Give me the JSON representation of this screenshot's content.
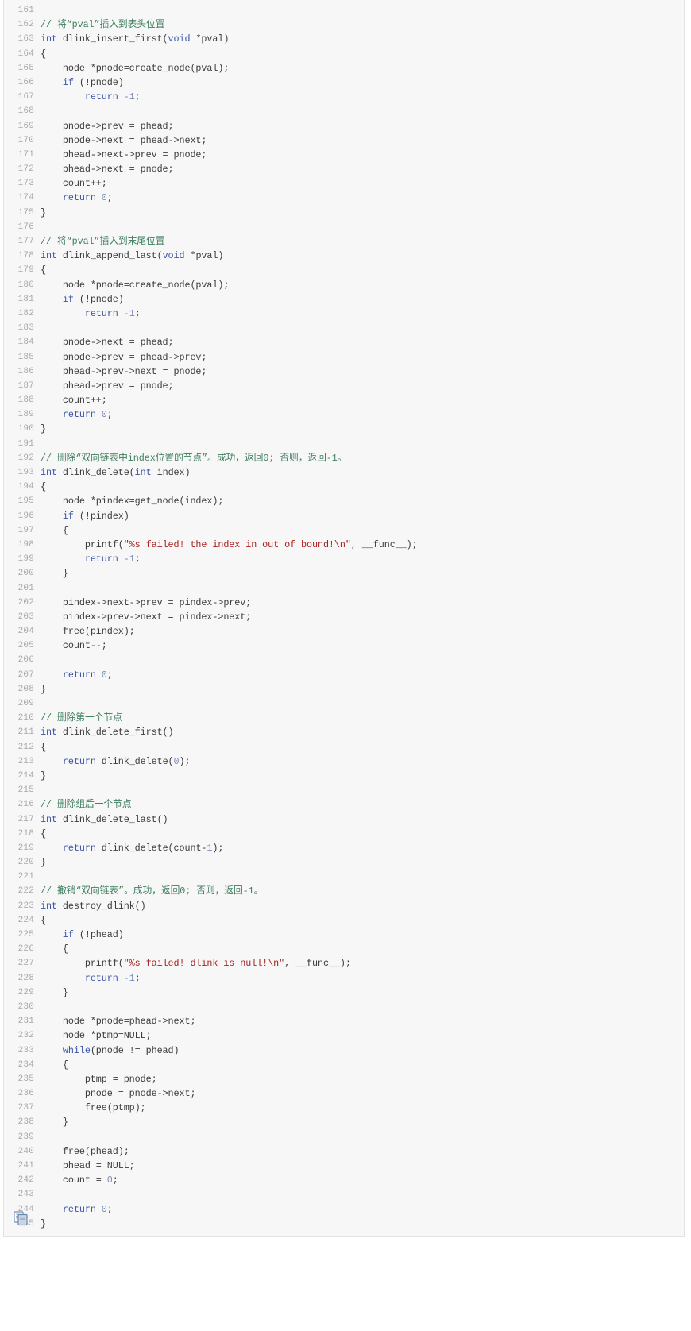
{
  "viewer": {
    "language": "C",
    "first_line_number": 161,
    "last_line_number": 245,
    "copy_icon": "copy-pages-icon",
    "colors": {
      "background": "#f7f7f7",
      "border": "#e3e3e3",
      "line_number": "#a8a8a8",
      "text": "#3b3b3b",
      "comment": "#3f7f5f",
      "keyword": "#3c55a8",
      "string": "#aa2222",
      "number": "#7a8ab8"
    }
  },
  "code": [
    {
      "n": "161",
      "tokens": []
    },
    {
      "n": "162",
      "tokens": [
        {
          "t": "com",
          "v": "// 将“pval”插入到表头位置"
        }
      ]
    },
    {
      "n": "163",
      "tokens": [
        {
          "t": "kw",
          "v": "int"
        },
        {
          "t": "pln",
          "v": " dlink_insert_first("
        },
        {
          "t": "kw",
          "v": "void"
        },
        {
          "t": "pln",
          "v": " *pval)"
        }
      ]
    },
    {
      "n": "164",
      "tokens": [
        {
          "t": "pln",
          "v": "{"
        }
      ]
    },
    {
      "n": "165",
      "tokens": [
        {
          "t": "pln",
          "v": "    node *pnode=create_node(pval);"
        }
      ]
    },
    {
      "n": "166",
      "tokens": [
        {
          "t": "pln",
          "v": "    "
        },
        {
          "t": "kw",
          "v": "if"
        },
        {
          "t": "pln",
          "v": " (!pnode)"
        }
      ]
    },
    {
      "n": "167",
      "tokens": [
        {
          "t": "pln",
          "v": "        "
        },
        {
          "t": "kw",
          "v": "return"
        },
        {
          "t": "pln",
          "v": " "
        },
        {
          "t": "num",
          "v": "-1"
        },
        {
          "t": "pln",
          "v": ";"
        }
      ]
    },
    {
      "n": "168",
      "tokens": []
    },
    {
      "n": "169",
      "tokens": [
        {
          "t": "pln",
          "v": "    pnode->prev = phead;"
        }
      ]
    },
    {
      "n": "170",
      "tokens": [
        {
          "t": "pln",
          "v": "    pnode->next = phead->next;"
        }
      ]
    },
    {
      "n": "171",
      "tokens": [
        {
          "t": "pln",
          "v": "    phead->next->prev = pnode;"
        }
      ]
    },
    {
      "n": "172",
      "tokens": [
        {
          "t": "pln",
          "v": "    phead->next = pnode;"
        }
      ]
    },
    {
      "n": "173",
      "tokens": [
        {
          "t": "pln",
          "v": "    count++;"
        }
      ]
    },
    {
      "n": "174",
      "tokens": [
        {
          "t": "pln",
          "v": "    "
        },
        {
          "t": "kw",
          "v": "return"
        },
        {
          "t": "pln",
          "v": " "
        },
        {
          "t": "num",
          "v": "0"
        },
        {
          "t": "pln",
          "v": ";"
        }
      ]
    },
    {
      "n": "175",
      "tokens": [
        {
          "t": "pln",
          "v": "}"
        }
      ]
    },
    {
      "n": "176",
      "tokens": []
    },
    {
      "n": "177",
      "tokens": [
        {
          "t": "com",
          "v": "// 将“pval”插入到末尾位置"
        }
      ]
    },
    {
      "n": "178",
      "tokens": [
        {
          "t": "kw",
          "v": "int"
        },
        {
          "t": "pln",
          "v": " dlink_append_last("
        },
        {
          "t": "kw",
          "v": "void"
        },
        {
          "t": "pln",
          "v": " *pval)"
        }
      ]
    },
    {
      "n": "179",
      "tokens": [
        {
          "t": "pln",
          "v": "{"
        }
      ]
    },
    {
      "n": "180",
      "tokens": [
        {
          "t": "pln",
          "v": "    node *pnode=create_node(pval);"
        }
      ]
    },
    {
      "n": "181",
      "tokens": [
        {
          "t": "pln",
          "v": "    "
        },
        {
          "t": "kw",
          "v": "if"
        },
        {
          "t": "pln",
          "v": " (!pnode)"
        }
      ]
    },
    {
      "n": "182",
      "tokens": [
        {
          "t": "pln",
          "v": "        "
        },
        {
          "t": "kw",
          "v": "return"
        },
        {
          "t": "pln",
          "v": " "
        },
        {
          "t": "num",
          "v": "-1"
        },
        {
          "t": "pln",
          "v": ";"
        }
      ]
    },
    {
      "n": "183",
      "tokens": []
    },
    {
      "n": "184",
      "tokens": [
        {
          "t": "pln",
          "v": "    pnode->next = phead;"
        }
      ]
    },
    {
      "n": "185",
      "tokens": [
        {
          "t": "pln",
          "v": "    pnode->prev = phead->prev;"
        }
      ]
    },
    {
      "n": "186",
      "tokens": [
        {
          "t": "pln",
          "v": "    phead->prev->next = pnode;"
        }
      ]
    },
    {
      "n": "187",
      "tokens": [
        {
          "t": "pln",
          "v": "    phead->prev = pnode;"
        }
      ]
    },
    {
      "n": "188",
      "tokens": [
        {
          "t": "pln",
          "v": "    count++;"
        }
      ]
    },
    {
      "n": "189",
      "tokens": [
        {
          "t": "pln",
          "v": "    "
        },
        {
          "t": "kw",
          "v": "return"
        },
        {
          "t": "pln",
          "v": " "
        },
        {
          "t": "num",
          "v": "0"
        },
        {
          "t": "pln",
          "v": ";"
        }
      ]
    },
    {
      "n": "190",
      "tokens": [
        {
          "t": "pln",
          "v": "}"
        }
      ]
    },
    {
      "n": "191",
      "tokens": []
    },
    {
      "n": "192",
      "tokens": [
        {
          "t": "com",
          "v": "// 删除“双向链表中index位置的节点”。成功，返回0; 否则，返回-1。"
        }
      ]
    },
    {
      "n": "193",
      "tokens": [
        {
          "t": "kw",
          "v": "int"
        },
        {
          "t": "pln",
          "v": " dlink_delete("
        },
        {
          "t": "kw",
          "v": "int"
        },
        {
          "t": "pln",
          "v": " index)"
        }
      ]
    },
    {
      "n": "194",
      "tokens": [
        {
          "t": "pln",
          "v": "{"
        }
      ]
    },
    {
      "n": "195",
      "tokens": [
        {
          "t": "pln",
          "v": "    node *pindex=get_node(index);"
        }
      ]
    },
    {
      "n": "196",
      "tokens": [
        {
          "t": "pln",
          "v": "    "
        },
        {
          "t": "kw",
          "v": "if"
        },
        {
          "t": "pln",
          "v": " (!pindex)"
        }
      ]
    },
    {
      "n": "197",
      "tokens": [
        {
          "t": "pln",
          "v": "    {"
        }
      ]
    },
    {
      "n": "198",
      "tokens": [
        {
          "t": "pln",
          "v": "        printf("
        },
        {
          "t": "str",
          "v": "\"%s failed! the index in out of bound!\\n\""
        },
        {
          "t": "pln",
          "v": ", __func__);"
        }
      ]
    },
    {
      "n": "199",
      "tokens": [
        {
          "t": "pln",
          "v": "        "
        },
        {
          "t": "kw",
          "v": "return"
        },
        {
          "t": "pln",
          "v": " "
        },
        {
          "t": "num",
          "v": "-1"
        },
        {
          "t": "pln",
          "v": ";"
        }
      ]
    },
    {
      "n": "200",
      "tokens": [
        {
          "t": "pln",
          "v": "    }"
        }
      ]
    },
    {
      "n": "201",
      "tokens": []
    },
    {
      "n": "202",
      "tokens": [
        {
          "t": "pln",
          "v": "    pindex->next->prev = pindex->prev;"
        }
      ]
    },
    {
      "n": "203",
      "tokens": [
        {
          "t": "pln",
          "v": "    pindex->prev->next = pindex->next;"
        }
      ]
    },
    {
      "n": "204",
      "tokens": [
        {
          "t": "pln",
          "v": "    free(pindex);"
        }
      ]
    },
    {
      "n": "205",
      "tokens": [
        {
          "t": "pln",
          "v": "    count--;"
        }
      ]
    },
    {
      "n": "206",
      "tokens": []
    },
    {
      "n": "207",
      "tokens": [
        {
          "t": "pln",
          "v": "    "
        },
        {
          "t": "kw",
          "v": "return"
        },
        {
          "t": "pln",
          "v": " "
        },
        {
          "t": "num",
          "v": "0"
        },
        {
          "t": "pln",
          "v": ";"
        }
      ]
    },
    {
      "n": "208",
      "tokens": [
        {
          "t": "pln",
          "v": "}"
        }
      ]
    },
    {
      "n": "209",
      "tokens": []
    },
    {
      "n": "210",
      "tokens": [
        {
          "t": "com",
          "v": "// 删除第一个节点"
        }
      ]
    },
    {
      "n": "211",
      "tokens": [
        {
          "t": "kw",
          "v": "int"
        },
        {
          "t": "pln",
          "v": " dlink_delete_first()"
        }
      ]
    },
    {
      "n": "212",
      "tokens": [
        {
          "t": "pln",
          "v": "{"
        }
      ]
    },
    {
      "n": "213",
      "tokens": [
        {
          "t": "pln",
          "v": "    "
        },
        {
          "t": "kw",
          "v": "return"
        },
        {
          "t": "pln",
          "v": " dlink_delete("
        },
        {
          "t": "num",
          "v": "0"
        },
        {
          "t": "pln",
          "v": ");"
        }
      ]
    },
    {
      "n": "214",
      "tokens": [
        {
          "t": "pln",
          "v": "}"
        }
      ]
    },
    {
      "n": "215",
      "tokens": []
    },
    {
      "n": "216",
      "tokens": [
        {
          "t": "com",
          "v": "// 删除组后一个节点"
        }
      ]
    },
    {
      "n": "217",
      "tokens": [
        {
          "t": "kw",
          "v": "int"
        },
        {
          "t": "pln",
          "v": " dlink_delete_last()"
        }
      ]
    },
    {
      "n": "218",
      "tokens": [
        {
          "t": "pln",
          "v": "{"
        }
      ]
    },
    {
      "n": "219",
      "tokens": [
        {
          "t": "pln",
          "v": "    "
        },
        {
          "t": "kw",
          "v": "return"
        },
        {
          "t": "pln",
          "v": " dlink_delete(count-"
        },
        {
          "t": "num",
          "v": "1"
        },
        {
          "t": "pln",
          "v": ");"
        }
      ]
    },
    {
      "n": "220",
      "tokens": [
        {
          "t": "pln",
          "v": "}"
        }
      ]
    },
    {
      "n": "221",
      "tokens": []
    },
    {
      "n": "222",
      "tokens": [
        {
          "t": "com",
          "v": "// 撤销“双向链表”。成功，返回0; 否则，返回-1。"
        }
      ]
    },
    {
      "n": "223",
      "tokens": [
        {
          "t": "kw",
          "v": "int"
        },
        {
          "t": "pln",
          "v": " destroy_dlink()"
        }
      ]
    },
    {
      "n": "224",
      "tokens": [
        {
          "t": "pln",
          "v": "{"
        }
      ]
    },
    {
      "n": "225",
      "tokens": [
        {
          "t": "pln",
          "v": "    "
        },
        {
          "t": "kw",
          "v": "if"
        },
        {
          "t": "pln",
          "v": " (!phead)"
        }
      ]
    },
    {
      "n": "226",
      "tokens": [
        {
          "t": "pln",
          "v": "    {"
        }
      ]
    },
    {
      "n": "227",
      "tokens": [
        {
          "t": "pln",
          "v": "        printf("
        },
        {
          "t": "str",
          "v": "\"%s failed! dlink is null!\\n\""
        },
        {
          "t": "pln",
          "v": ", __func__);"
        }
      ]
    },
    {
      "n": "228",
      "tokens": [
        {
          "t": "pln",
          "v": "        "
        },
        {
          "t": "kw",
          "v": "return"
        },
        {
          "t": "pln",
          "v": " "
        },
        {
          "t": "num",
          "v": "-1"
        },
        {
          "t": "pln",
          "v": ";"
        }
      ]
    },
    {
      "n": "229",
      "tokens": [
        {
          "t": "pln",
          "v": "    }"
        }
      ]
    },
    {
      "n": "230",
      "tokens": []
    },
    {
      "n": "231",
      "tokens": [
        {
          "t": "pln",
          "v": "    node *pnode=phead->next;"
        }
      ]
    },
    {
      "n": "232",
      "tokens": [
        {
          "t": "pln",
          "v": "    node *ptmp=NULL;"
        }
      ]
    },
    {
      "n": "233",
      "tokens": [
        {
          "t": "pln",
          "v": "    "
        },
        {
          "t": "kw",
          "v": "while"
        },
        {
          "t": "pln",
          "v": "(pnode != phead)"
        }
      ]
    },
    {
      "n": "234",
      "tokens": [
        {
          "t": "pln",
          "v": "    {"
        }
      ]
    },
    {
      "n": "235",
      "tokens": [
        {
          "t": "pln",
          "v": "        ptmp = pnode;"
        }
      ]
    },
    {
      "n": "236",
      "tokens": [
        {
          "t": "pln",
          "v": "        pnode = pnode->next;"
        }
      ]
    },
    {
      "n": "237",
      "tokens": [
        {
          "t": "pln",
          "v": "        free(ptmp);"
        }
      ]
    },
    {
      "n": "238",
      "tokens": [
        {
          "t": "pln",
          "v": "    }"
        }
      ]
    },
    {
      "n": "239",
      "tokens": []
    },
    {
      "n": "240",
      "tokens": [
        {
          "t": "pln",
          "v": "    free(phead);"
        }
      ]
    },
    {
      "n": "241",
      "tokens": [
        {
          "t": "pln",
          "v": "    phead = NULL;"
        }
      ]
    },
    {
      "n": "242",
      "tokens": [
        {
          "t": "pln",
          "v": "    count = "
        },
        {
          "t": "num",
          "v": "0"
        },
        {
          "t": "pln",
          "v": ";"
        }
      ]
    },
    {
      "n": "243",
      "tokens": []
    },
    {
      "n": "244",
      "tokens": [
        {
          "t": "pln",
          "v": "    "
        },
        {
          "t": "kw",
          "v": "return"
        },
        {
          "t": "pln",
          "v": " "
        },
        {
          "t": "num",
          "v": "0"
        },
        {
          "t": "pln",
          "v": ";"
        }
      ]
    },
    {
      "n": "245",
      "tokens": [
        {
          "t": "pln",
          "v": "}"
        }
      ]
    }
  ]
}
